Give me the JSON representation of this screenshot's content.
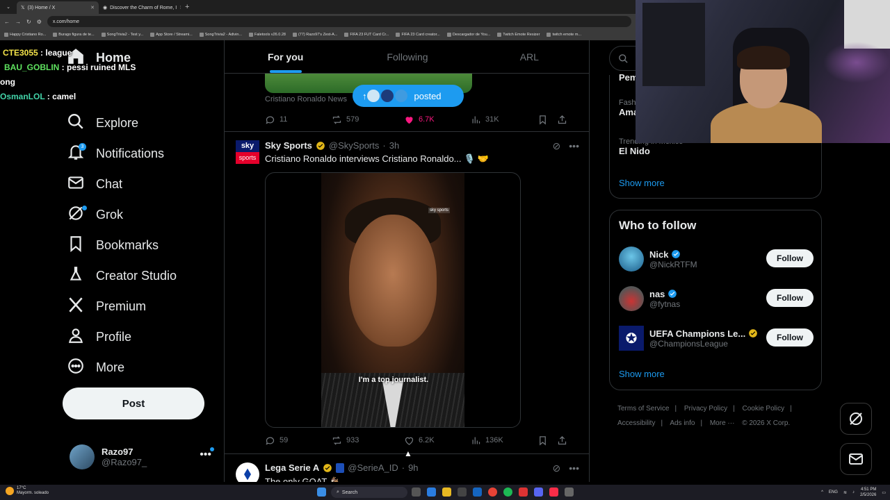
{
  "browser": {
    "tabs": [
      {
        "label": "(3) Home / X",
        "active": true
      },
      {
        "label": "Discover the Charm of Rome, I",
        "active": false
      }
    ],
    "url": "x.com/home",
    "bookmarks": [
      "Happy Cristiano Ro...",
      "Burago figura de te...",
      "SongTrivia2 - Test y...",
      "App Store / Streami...",
      "SongTrivia2 - Adivin...",
      "Faletools v26.0.28",
      "(77) Razo97's Zest-A...",
      "FIFA 23 FUT Card Cr...",
      "FIFA 23 Card creator...",
      "Descargador de You...",
      "Twitch Emote Resizer",
      "twitch emote m..."
    ]
  },
  "chat": [
    {
      "user": "CTE3055",
      "sep": " : ",
      "msg": "league",
      "color": "#f5e44a"
    },
    {
      "user": "BAU_GOBLIN",
      "sep": " : ",
      "msg": "pessi ruined MLS ong",
      "color": "#5fe35f"
    },
    {
      "user": "OsmanLOL",
      "sep": " : ",
      "msg": "camel",
      "color": "#42d3a8"
    }
  ],
  "nav": {
    "items": [
      {
        "label": "Home",
        "icon": "home-icon"
      },
      {
        "label": "Explore",
        "icon": "search-icon"
      },
      {
        "label": "Notifications",
        "icon": "bell-icon",
        "badge": "3"
      },
      {
        "label": "Chat",
        "icon": "mail-icon"
      },
      {
        "label": "Grok",
        "icon": "grok-icon"
      },
      {
        "label": "Bookmarks",
        "icon": "bookmark-icon"
      },
      {
        "label": "Creator Studio",
        "icon": "flask-icon"
      },
      {
        "label": "Premium",
        "icon": "x-logo-icon"
      },
      {
        "label": "Profile",
        "icon": "person-icon"
      },
      {
        "label": "More",
        "icon": "more-circle-icon"
      }
    ],
    "post_label": "Post",
    "account": {
      "name": "Razo97",
      "handle": "@Razo97_"
    }
  },
  "timeline": {
    "tabs": [
      "For you",
      "Following",
      "ARL"
    ],
    "posted_pill": "posted",
    "prev_post": {
      "source": "Cristiano Ronaldo News",
      "replies": "11",
      "reposts": "579",
      "likes": "6.7K",
      "views": "31K"
    },
    "post": {
      "name": "Sky Sports",
      "handle": "@SkySports",
      "time": "3h",
      "text": "Cristiano Ronaldo interviews Cristiano Ronaldo... 🎙️ 🤝",
      "video_logo": "sky sports",
      "caption": "I'm a top journalist.",
      "replies": "59",
      "reposts": "933",
      "likes": "6.2K",
      "views": "136K",
      "avatar_top": "sky",
      "avatar_bottom": "sports"
    },
    "next_post": {
      "name": "Lega Serie A",
      "handle": "@SerieA_ID",
      "time": "9h",
      "text": "The only GOAT 🐐"
    }
  },
  "right": {
    "search_placeholder": "Se",
    "trends": [
      {
        "meta": "",
        "title": "Pem"
      },
      {
        "meta": "Fash",
        "title": "Ama"
      },
      {
        "meta": "Trending in Mexico",
        "title": "El Nido"
      }
    ],
    "show_more": "Show more",
    "who_to_follow": {
      "title": "Who to follow",
      "people": [
        {
          "name": "Nick",
          "handle": "@NickRTFM",
          "verified": "blue"
        },
        {
          "name": "nas",
          "handle": "@fytnas",
          "verified": "blue"
        },
        {
          "name": "UEFA Champions Le...",
          "handle": "@ChampionsLeague",
          "verified": "gold"
        }
      ],
      "follow_label": "Follow",
      "show_more": "Show more"
    },
    "footer": [
      "Terms of Service",
      "Privacy Policy",
      "Cookie Policy",
      "Accessibility",
      "Ads info",
      "More ···",
      "© 2026 X Corp."
    ]
  },
  "taskbar": {
    "temp": "17°C",
    "weather": "Mayorm. soleado",
    "search": "Search",
    "lang": "ENG",
    "time": "4:51 PM",
    "date": "2/5/2026"
  }
}
